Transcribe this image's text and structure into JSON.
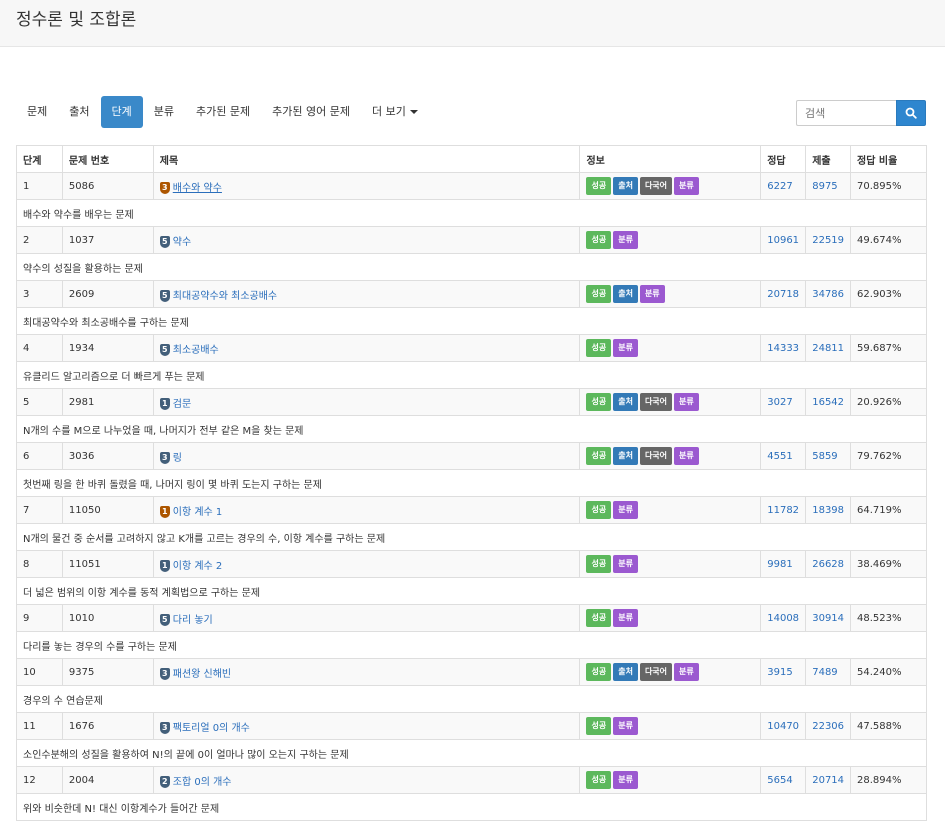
{
  "header": {
    "title": "정수론 및 조합론"
  },
  "nav": {
    "tabs": [
      {
        "label": "문제",
        "active": false
      },
      {
        "label": "출처",
        "active": false
      },
      {
        "label": "단계",
        "active": true
      },
      {
        "label": "분류",
        "active": false
      },
      {
        "label": "추가된 문제",
        "active": false
      },
      {
        "label": "추가된 영어 문제",
        "active": false
      },
      {
        "label": "더 보기",
        "active": false,
        "dropdown": true
      }
    ],
    "search": {
      "placeholder": "검색",
      "icon": "search-icon"
    }
  },
  "table": {
    "headers": [
      "단계",
      "문제 번호",
      "제목",
      "정보",
      "정답",
      "제출",
      "정답 비율"
    ],
    "rows": [
      {
        "step": "1",
        "id": "5086",
        "tier": "3",
        "tier_color": "bronze",
        "title": "배수와 약수",
        "underline": true,
        "badges": [
          "success",
          "source",
          "multi",
          "class"
        ],
        "correct": "6227",
        "submit": "8975",
        "ratio": "70.895%",
        "desc": "배수와 약수를 배우는 문제"
      },
      {
        "step": "2",
        "id": "1037",
        "tier": "5",
        "tier_color": "silver",
        "title": "약수",
        "badges": [
          "success",
          "class"
        ],
        "correct": "10961",
        "submit": "22519",
        "ratio": "49.674%",
        "desc": "약수의 성질을 활용하는 문제"
      },
      {
        "step": "3",
        "id": "2609",
        "tier": "5",
        "tier_color": "silver",
        "title": "최대공약수와 최소공배수",
        "badges": [
          "success",
          "source",
          "class"
        ],
        "correct": "20718",
        "submit": "34786",
        "ratio": "62.903%",
        "desc": "최대공약수와 최소공배수를 구하는 문제"
      },
      {
        "step": "4",
        "id": "1934",
        "tier": "5",
        "tier_color": "silver",
        "title": "최소공배수",
        "badges": [
          "success",
          "class"
        ],
        "correct": "14333",
        "submit": "24811",
        "ratio": "59.687%",
        "desc": "유클리드 알고리즘으로 더 빠르게 푸는 문제"
      },
      {
        "step": "5",
        "id": "2981",
        "tier": "1",
        "tier_color": "silver",
        "title": "검문",
        "badges": [
          "success",
          "source",
          "multi",
          "class"
        ],
        "correct": "3027",
        "submit": "16542",
        "ratio": "20.926%",
        "desc": "N개의 수를 M으로 나누었을 때, 나머지가 전부 같은 M을 찾는 문제"
      },
      {
        "step": "6",
        "id": "3036",
        "tier": "3",
        "tier_color": "silver",
        "title": "링",
        "badges": [
          "success",
          "source",
          "multi",
          "class"
        ],
        "correct": "4551",
        "submit": "5859",
        "ratio": "79.762%",
        "desc": "첫번째 링을 한 바퀴 돌렸을 때, 나머지 링이 몇 바퀴 도는지 구하는 문제"
      },
      {
        "step": "7",
        "id": "11050",
        "tier": "1",
        "tier_color": "bronze",
        "title": "이항 계수 1",
        "badges": [
          "success",
          "class"
        ],
        "correct": "11782",
        "submit": "18398",
        "ratio": "64.719%",
        "desc": "N개의 물건 중 순서를 고려하지 않고 K개를 고르는 경우의 수, 이항 계수를 구하는 문제"
      },
      {
        "step": "8",
        "id": "11051",
        "tier": "1",
        "tier_color": "silver",
        "title": "이항 계수 2",
        "badges": [
          "success",
          "class"
        ],
        "correct": "9981",
        "submit": "26628",
        "ratio": "38.469%",
        "desc": "더 넓은 범위의 이항 계수를 동적 계획법으로 구하는 문제"
      },
      {
        "step": "9",
        "id": "1010",
        "tier": "5",
        "tier_color": "silver",
        "title": "다리 놓기",
        "badges": [
          "success",
          "class"
        ],
        "correct": "14008",
        "submit": "30914",
        "ratio": "48.523%",
        "desc": "다리를 놓는 경우의 수를 구하는 문제"
      },
      {
        "step": "10",
        "id": "9375",
        "tier": "3",
        "tier_color": "silver",
        "title": "패션왕 신해빈",
        "badges": [
          "success",
          "source",
          "multi",
          "class"
        ],
        "correct": "3915",
        "submit": "7489",
        "ratio": "54.240%",
        "desc": "경우의 수 연습문제"
      },
      {
        "step": "11",
        "id": "1676",
        "tier": "3",
        "tier_color": "silver",
        "title": "팩토리얼 0의 개수",
        "badges": [
          "success",
          "class"
        ],
        "correct": "10470",
        "submit": "22306",
        "ratio": "47.588%",
        "desc": "소인수분해의 성질을 활용하여 N!의 끝에 0이 얼마나 많이 오는지 구하는 문제"
      },
      {
        "step": "12",
        "id": "2004",
        "tier": "2",
        "tier_color": "silver",
        "title": "조합 0의 개수",
        "badges": [
          "success",
          "class"
        ],
        "correct": "5654",
        "submit": "20714",
        "ratio": "28.894%",
        "desc": "위와 비슷한데 N! 대신 이항계수가 들어간 문제"
      }
    ],
    "badge_labels": {
      "success": "성공",
      "source": "출처",
      "multi": "다국어",
      "class": "분류"
    }
  },
  "colors": {
    "tab_active": "#3a89c9",
    "link": "#2a6ebb",
    "badge_success": "#5cb85c",
    "badge_source": "#337ab7",
    "badge_multi": "#666666",
    "badge_class": "#9b59d0",
    "tier_bronze": "#ad5600",
    "tier_silver": "#435f7a"
  }
}
